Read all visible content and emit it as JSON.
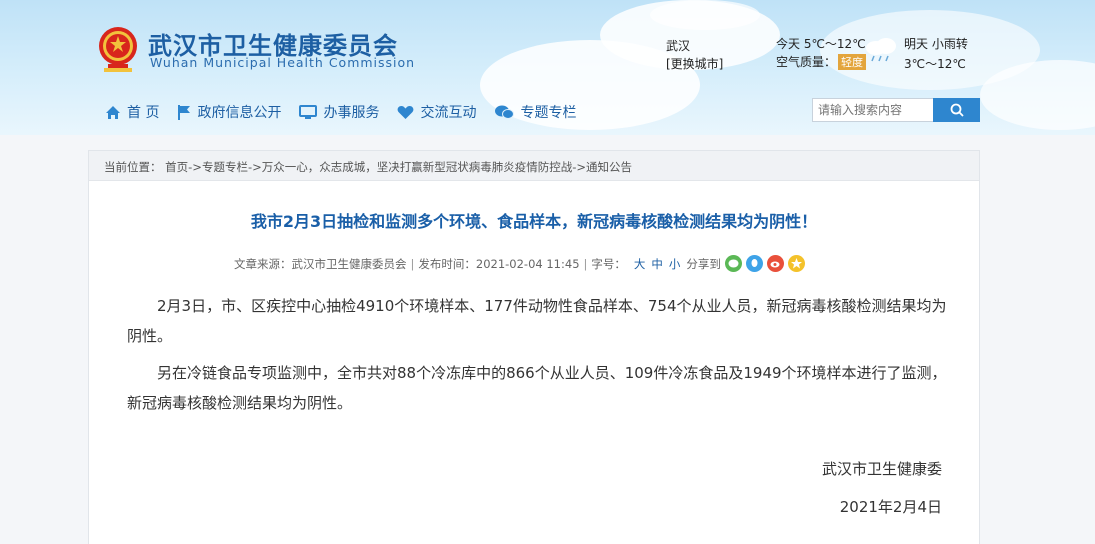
{
  "header": {
    "title": "武汉市卫生健康委员会",
    "subtitle": "Wuhan Municipal Health Commission"
  },
  "weather": {
    "city": "武汉",
    "change_city": "[更换城市]",
    "today": "今天 5℃～12℃",
    "aq_label": "空气质量：",
    "aq_value": "轻度",
    "tomorrow": "明天 小雨转",
    "tomorrow_temp": "3℃～12℃"
  },
  "nav": [
    {
      "label": "首 页",
      "icon": "home-icon"
    },
    {
      "label": "政府信息公开",
      "icon": "flag-icon"
    },
    {
      "label": "办事服务",
      "icon": "monitor-icon"
    },
    {
      "label": "交流互动",
      "icon": "heart-icon"
    },
    {
      "label": "专题专栏",
      "icon": "chat-icon"
    }
  ],
  "search": {
    "placeholder": "请输入搜索内容"
  },
  "breadcrumb": {
    "prefix": "当前位置：",
    "path": "首页->专题专栏->万众一心，众志成城，坚决打赢新型冠状病毒肺炎疫情防控战->通知公告"
  },
  "article": {
    "title": "我市2月3日抽检和监测多个环境、食品样本，新冠病毒核酸检测结果均为阴性！",
    "source_label": "文章来源：",
    "source": "武汉市卫生健康委员会",
    "time_label": "发布时间：",
    "time": "2021-02-04 11:45",
    "font_label": "字号：",
    "font_sizes": [
      "大",
      "中",
      "小"
    ],
    "share_label": "分享到",
    "paragraphs": [
      "2月3日，市、区疾控中心抽检4910个环境样本、177件动物性食品样本、754个从业人员，新冠病毒核酸检测结果均为阴性。",
      "另在冷链食品专项监测中，全市共对88个冷冻库中的866个从业人员、109件冷冻食品及1949个环境样本进行了监测，新冠病毒核酸检测结果均为阴性。"
    ],
    "signature": "武汉市卫生健康委",
    "date": "2021年2月4日"
  },
  "colors": {
    "brand": "#1d5fa3",
    "search_button": "#2e86cf",
    "aq_badge": "#e3a53d"
  }
}
